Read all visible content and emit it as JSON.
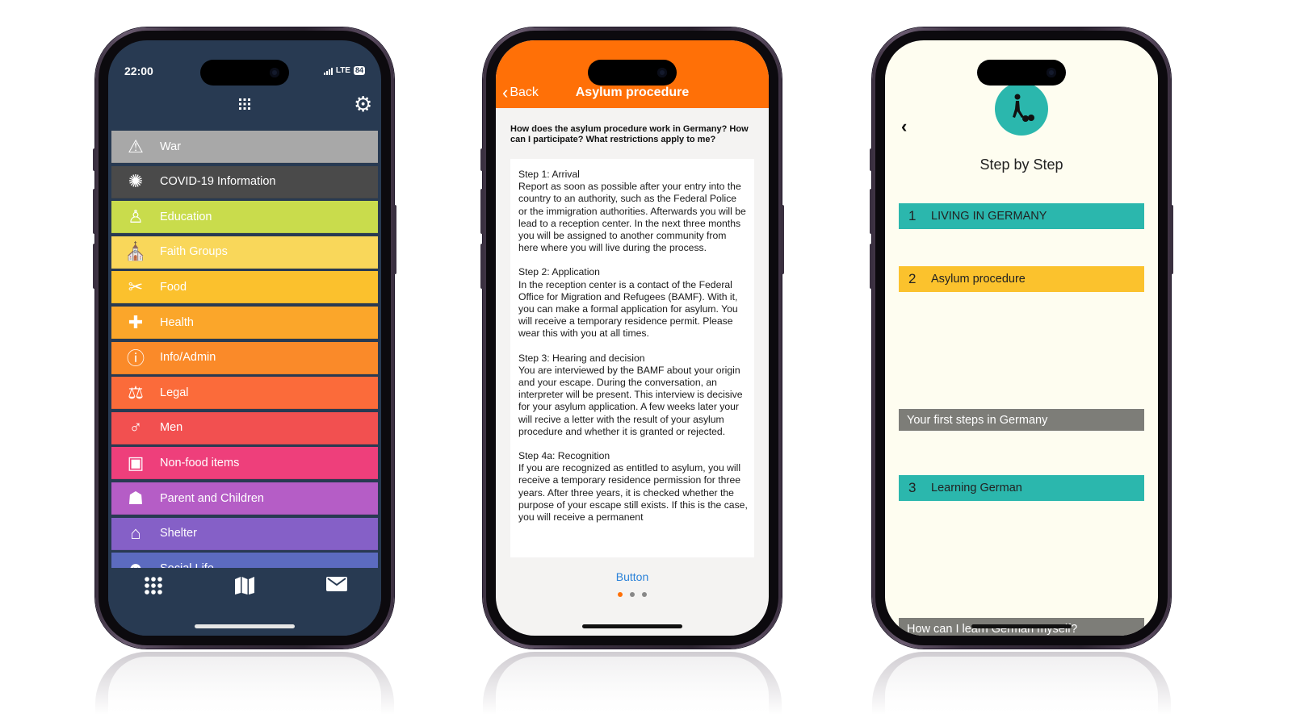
{
  "phone1": {
    "status_time": "22:00",
    "status_network": "LTE",
    "status_battery": "84",
    "menu": [
      {
        "label": "War",
        "color": "#a8a8a8",
        "icon": "warning-icon"
      },
      {
        "label": "COVID-19 Information",
        "color": "#4a4a4a",
        "icon": "virus-icon"
      },
      {
        "label": "Education",
        "color": "#c9dc4c",
        "icon": "teacher-icon"
      },
      {
        "label": "Faith Groups",
        "color": "#f9d75a",
        "icon": "praying-hands-icon"
      },
      {
        "label": "Food",
        "color": "#fbc12d",
        "icon": "fork-knife-icon"
      },
      {
        "label": "Health",
        "color": "#fba62a",
        "icon": "first-aid-icon"
      },
      {
        "label": "Info/Admin",
        "color": "#fa8a29",
        "icon": "info-icon"
      },
      {
        "label": "Legal",
        "color": "#fb6b3a",
        "icon": "scales-icon"
      },
      {
        "label": "Men",
        "color": "#f25050",
        "icon": "male-symbol-icon"
      },
      {
        "label": "Non-food items",
        "color": "#ee3f7b",
        "icon": "box-icon"
      },
      {
        "label": "Parent and Children",
        "color": "#b55dc6",
        "icon": "family-icon"
      },
      {
        "label": "Shelter",
        "color": "#8560c7",
        "icon": "house-icon"
      },
      {
        "label": "Social Life",
        "color": "#5c6bc0",
        "icon": "people-icon"
      }
    ]
  },
  "phone2": {
    "back_label": "Back",
    "title": "Asylum procedure",
    "question": "How does the asylum procedure work in Germany? How can I participate? What restrictions apply to me?",
    "steps": [
      {
        "title": "Step 1: Arrival",
        "body": "Report as soon as possible after your entry into the country to an authority, such as the Federal Police or the immigration authorities. Afterwards you will be lead to a reception center. In the next three months you will be assigned to another community from here where you will live during the process."
      },
      {
        "title": "Step 2: Application",
        "body": "In the reception center is a contact of the Federal Office for Migration and Refugees (BAMF). With it, you can make a formal application for asylum. You will receive a temporary residence permit. Please wear this with you at all times."
      },
      {
        "title": "Step 3: Hearing and decision",
        "body": "You are interviewed by the BAMF about your origin and your escape. During the conversation, an interpreter will be present. This interview is decisive for your asylum application. A few weeks later your will recive a letter with the result of your asylum procedure and whether it is granted or rejected."
      },
      {
        "title": "Step 4a: Recognition",
        "body": "If you are recognized as entitled to asylum, you will receive a temporary residence permission for three years. After three years, it is checked whether the purpose of your escape still exists. If this is the case, you will receive a permanent"
      }
    ],
    "button_label": "Button",
    "pager_active": 1,
    "pager_count": 3
  },
  "phone3": {
    "title": "Step by Step",
    "bars": [
      {
        "kind": "step",
        "num": "1",
        "label": "LIVING IN GERMANY",
        "color": "#2bb7ad"
      },
      {
        "kind": "step",
        "num": "2",
        "label": "Asylum procedure",
        "color": "#fbc22d"
      },
      {
        "kind": "grey",
        "label": "Your first steps in Germany"
      },
      {
        "kind": "step",
        "num": "3",
        "label": "Learning German",
        "color": "#2bb7ad"
      },
      {
        "kind": "grey",
        "label": "How can I learn German myself?"
      }
    ]
  },
  "colors": {
    "orange": "#ff7007",
    "navy": "#283a52",
    "teal": "#2bb7ad",
    "cream": "#fefdf0",
    "link": "#2b82d9"
  }
}
